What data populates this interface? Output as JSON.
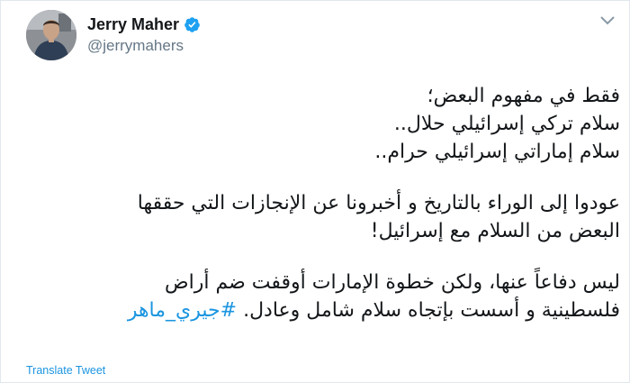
{
  "user": {
    "display_name": "Jerry Maher",
    "handle": "@jerrymahers",
    "verified_icon": "verified-badge-icon",
    "avatar_icon": "profile-photo"
  },
  "menu_icon": "chevron-down-icon",
  "tweet": {
    "paragraph1": [
      "فقط في مفهوم البعض؛",
      "سلام تركي إسرائيلي حلال..",
      "سلام إماراتي إسرائيلي حرام.."
    ],
    "paragraph2": [
      "عودوا إلى الوراء بالتاريخ و أخبرونا عن الإنجازات التي حققها",
      "البعض من السلام مع إسرائيل!"
    ],
    "paragraph3_line1": "ليس دفاعاً عنها، ولكن خطوة الإمارات أوقفت ضم أراض",
    "paragraph3_line2_text": "فلسطينية و أسست بإتجاه سلام شامل وعادل.",
    "hashtag": "#جيري_ماهر"
  },
  "translate_label": "Translate Tweet",
  "colors": {
    "link": "#1b95e0",
    "verified": "#1da1f2",
    "handle": "#657786",
    "text": "#14171a"
  }
}
